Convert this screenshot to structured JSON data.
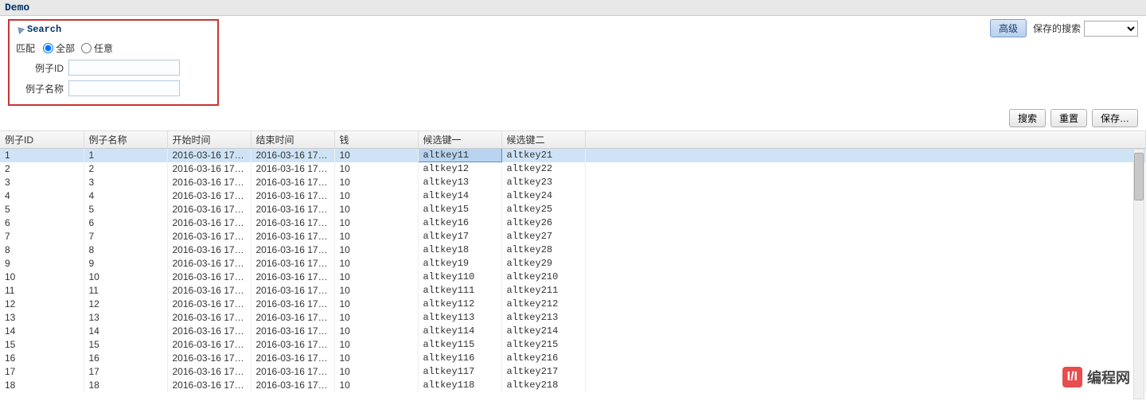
{
  "title": "Demo",
  "search": {
    "header": "Search",
    "match_label": "匹配",
    "radio_all": "全部",
    "radio_any": "任意",
    "field_id_label": "例子ID",
    "field_name_label": "例子名称",
    "field_id_value": "",
    "field_name_value": ""
  },
  "top_right": {
    "advanced": "高级",
    "saved_search_label": "保存的搜索"
  },
  "actions": {
    "search": "搜索",
    "reset": "重置",
    "save": "保存…"
  },
  "table": {
    "columns": [
      "例子ID",
      "例子名称",
      "开始时间",
      "结束时间",
      "钱",
      "候选键一",
      "候选键二"
    ],
    "rows": [
      {
        "id": "1",
        "name": "1",
        "start": "2016-03-16 17:…",
        "end": "2016-03-16 17:…",
        "money": "10",
        "alt1": "altkey11",
        "alt2": "altkey21",
        "selected": true
      },
      {
        "id": "2",
        "name": "2",
        "start": "2016-03-16 17:…",
        "end": "2016-03-16 17:…",
        "money": "10",
        "alt1": "altkey12",
        "alt2": "altkey22"
      },
      {
        "id": "3",
        "name": "3",
        "start": "2016-03-16 17:…",
        "end": "2016-03-16 17:…",
        "money": "10",
        "alt1": "altkey13",
        "alt2": "altkey23"
      },
      {
        "id": "4",
        "name": "4",
        "start": "2016-03-16 17:…",
        "end": "2016-03-16 17:…",
        "money": "10",
        "alt1": "altkey14",
        "alt2": "altkey24"
      },
      {
        "id": "5",
        "name": "5",
        "start": "2016-03-16 17:…",
        "end": "2016-03-16 17:…",
        "money": "10",
        "alt1": "altkey15",
        "alt2": "altkey25"
      },
      {
        "id": "6",
        "name": "6",
        "start": "2016-03-16 17:…",
        "end": "2016-03-16 17:…",
        "money": "10",
        "alt1": "altkey16",
        "alt2": "altkey26"
      },
      {
        "id": "7",
        "name": "7",
        "start": "2016-03-16 17:…",
        "end": "2016-03-16 17:…",
        "money": "10",
        "alt1": "altkey17",
        "alt2": "altkey27"
      },
      {
        "id": "8",
        "name": "8",
        "start": "2016-03-16 17:…",
        "end": "2016-03-16 17:…",
        "money": "10",
        "alt1": "altkey18",
        "alt2": "altkey28"
      },
      {
        "id": "9",
        "name": "9",
        "start": "2016-03-16 17:…",
        "end": "2016-03-16 17:…",
        "money": "10",
        "alt1": "altkey19",
        "alt2": "altkey29"
      },
      {
        "id": "10",
        "name": "10",
        "start": "2016-03-16 17:…",
        "end": "2016-03-16 17:…",
        "money": "10",
        "alt1": "altkey110",
        "alt2": "altkey210"
      },
      {
        "id": "11",
        "name": "11",
        "start": "2016-03-16 17:…",
        "end": "2016-03-16 17:…",
        "money": "10",
        "alt1": "altkey111",
        "alt2": "altkey211"
      },
      {
        "id": "12",
        "name": "12",
        "start": "2016-03-16 17:…",
        "end": "2016-03-16 17:…",
        "money": "10",
        "alt1": "altkey112",
        "alt2": "altkey212"
      },
      {
        "id": "13",
        "name": "13",
        "start": "2016-03-16 17:…",
        "end": "2016-03-16 17:…",
        "money": "10",
        "alt1": "altkey113",
        "alt2": "altkey213"
      },
      {
        "id": "14",
        "name": "14",
        "start": "2016-03-16 17:…",
        "end": "2016-03-16 17:…",
        "money": "10",
        "alt1": "altkey114",
        "alt2": "altkey214"
      },
      {
        "id": "15",
        "name": "15",
        "start": "2016-03-16 17:…",
        "end": "2016-03-16 17:…",
        "money": "10",
        "alt1": "altkey115",
        "alt2": "altkey215"
      },
      {
        "id": "16",
        "name": "16",
        "start": "2016-03-16 17:…",
        "end": "2016-03-16 17:…",
        "money": "10",
        "alt1": "altkey116",
        "alt2": "altkey216"
      },
      {
        "id": "17",
        "name": "17",
        "start": "2016-03-16 17:…",
        "end": "2016-03-16 17:…",
        "money": "10",
        "alt1": "altkey117",
        "alt2": "altkey217"
      },
      {
        "id": "18",
        "name": "18",
        "start": "2016-03-16 17:…",
        "end": "2016-03-16 17:…",
        "money": "10",
        "alt1": "altkey118",
        "alt2": "altkey218"
      }
    ]
  },
  "watermark": {
    "logo": "I/I",
    "text": "编程网"
  }
}
